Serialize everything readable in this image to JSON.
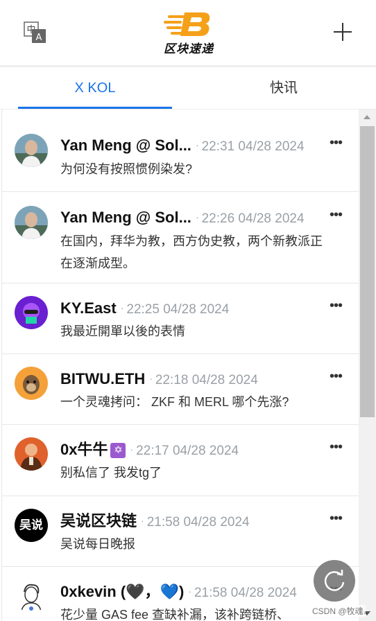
{
  "header": {
    "logo_text": "区块速递"
  },
  "tabs": [
    {
      "label": "X KOL",
      "active": true
    },
    {
      "label": "快讯",
      "active": false
    }
  ],
  "feed": [
    {
      "name": "Yan Meng @ Sol...",
      "time": "22:31 04/28 2024",
      "content": "为何没有按照惯例染发?",
      "avatar": "photo-man"
    },
    {
      "name": "Yan Meng @ Sol...",
      "time": "22:26 04/28 2024",
      "content": "在国内，拜华为教，西方伪史教，两个新教派正在逐渐成型。",
      "avatar": "photo-man"
    },
    {
      "name": "KY.East",
      "time": "22:25 04/28 2024",
      "content": "我最近開單以後的表情",
      "avatar": "purple-character"
    },
    {
      "name": "BITWU.ETH",
      "time": "22:18 04/28 2024",
      "content": "一个灵魂拷问： ZKF 和 MERL 哪个先涨?",
      "avatar": "ape-orange"
    },
    {
      "name": "0x牛牛",
      "badge": "✡",
      "time": "22:17 04/28 2024",
      "content": "别私信了 我发tg了",
      "avatar": "painting-man"
    },
    {
      "name": "吴说区块链",
      "time": "21:58 04/28 2024",
      "content": "吴说每日晚报",
      "avatar": "wu-logo",
      "avatar_text": "吴说"
    },
    {
      "name": "0xkevin (🖤，💙)",
      "time": "21:58 04/28 2024",
      "content": "花少量 GAS fee 查缺补漏，该补跨链桥、",
      "avatar": "sketch-man"
    }
  ],
  "separator": "·",
  "more_glyph": "•••",
  "watermark": "CSDN @牧魂.",
  "colors": {
    "accent": "#1a73e8",
    "logo": "#f5a019",
    "time": "#9aa0a6"
  }
}
